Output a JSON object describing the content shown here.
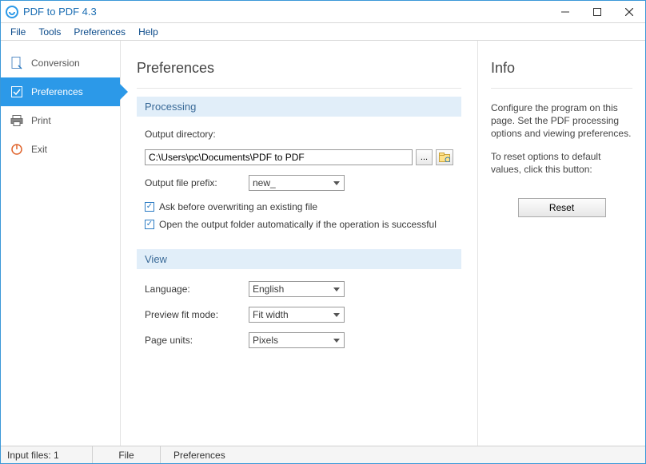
{
  "titlebar": {
    "title": "PDF to PDF 4.3"
  },
  "menu": {
    "file": "File",
    "tools": "Tools",
    "preferences": "Preferences",
    "help": "Help"
  },
  "sidebar": {
    "items": [
      {
        "label": "Conversion"
      },
      {
        "label": "Preferences"
      },
      {
        "label": "Print"
      },
      {
        "label": "Exit"
      }
    ]
  },
  "content": {
    "page_title": "Preferences",
    "processing": {
      "header": "Processing",
      "output_dir_label": "Output directory:",
      "output_dir_value": "C:\\Users\\pc\\Documents\\PDF to PDF",
      "browse_label": "...",
      "output_prefix_label": "Output file prefix:",
      "output_prefix_value": "new_",
      "ask_overwrite": "Ask before overwriting an existing file",
      "open_output": "Open the output folder automatically if the operation is successful"
    },
    "view": {
      "header": "View",
      "language_label": "Language:",
      "language_value": "English",
      "fitmode_label": "Preview fit mode:",
      "fitmode_value": "Fit width",
      "units_label": "Page units:",
      "units_value": "Pixels"
    }
  },
  "info": {
    "title": "Info",
    "line1": "Configure the program on this page. Set the PDF processing options and viewing preferences.",
    "line2": "To reset options to default values, click this button:",
    "reset": "Reset"
  },
  "status": {
    "input_files": "Input files: 1",
    "file": "File",
    "pref": "Preferences"
  }
}
